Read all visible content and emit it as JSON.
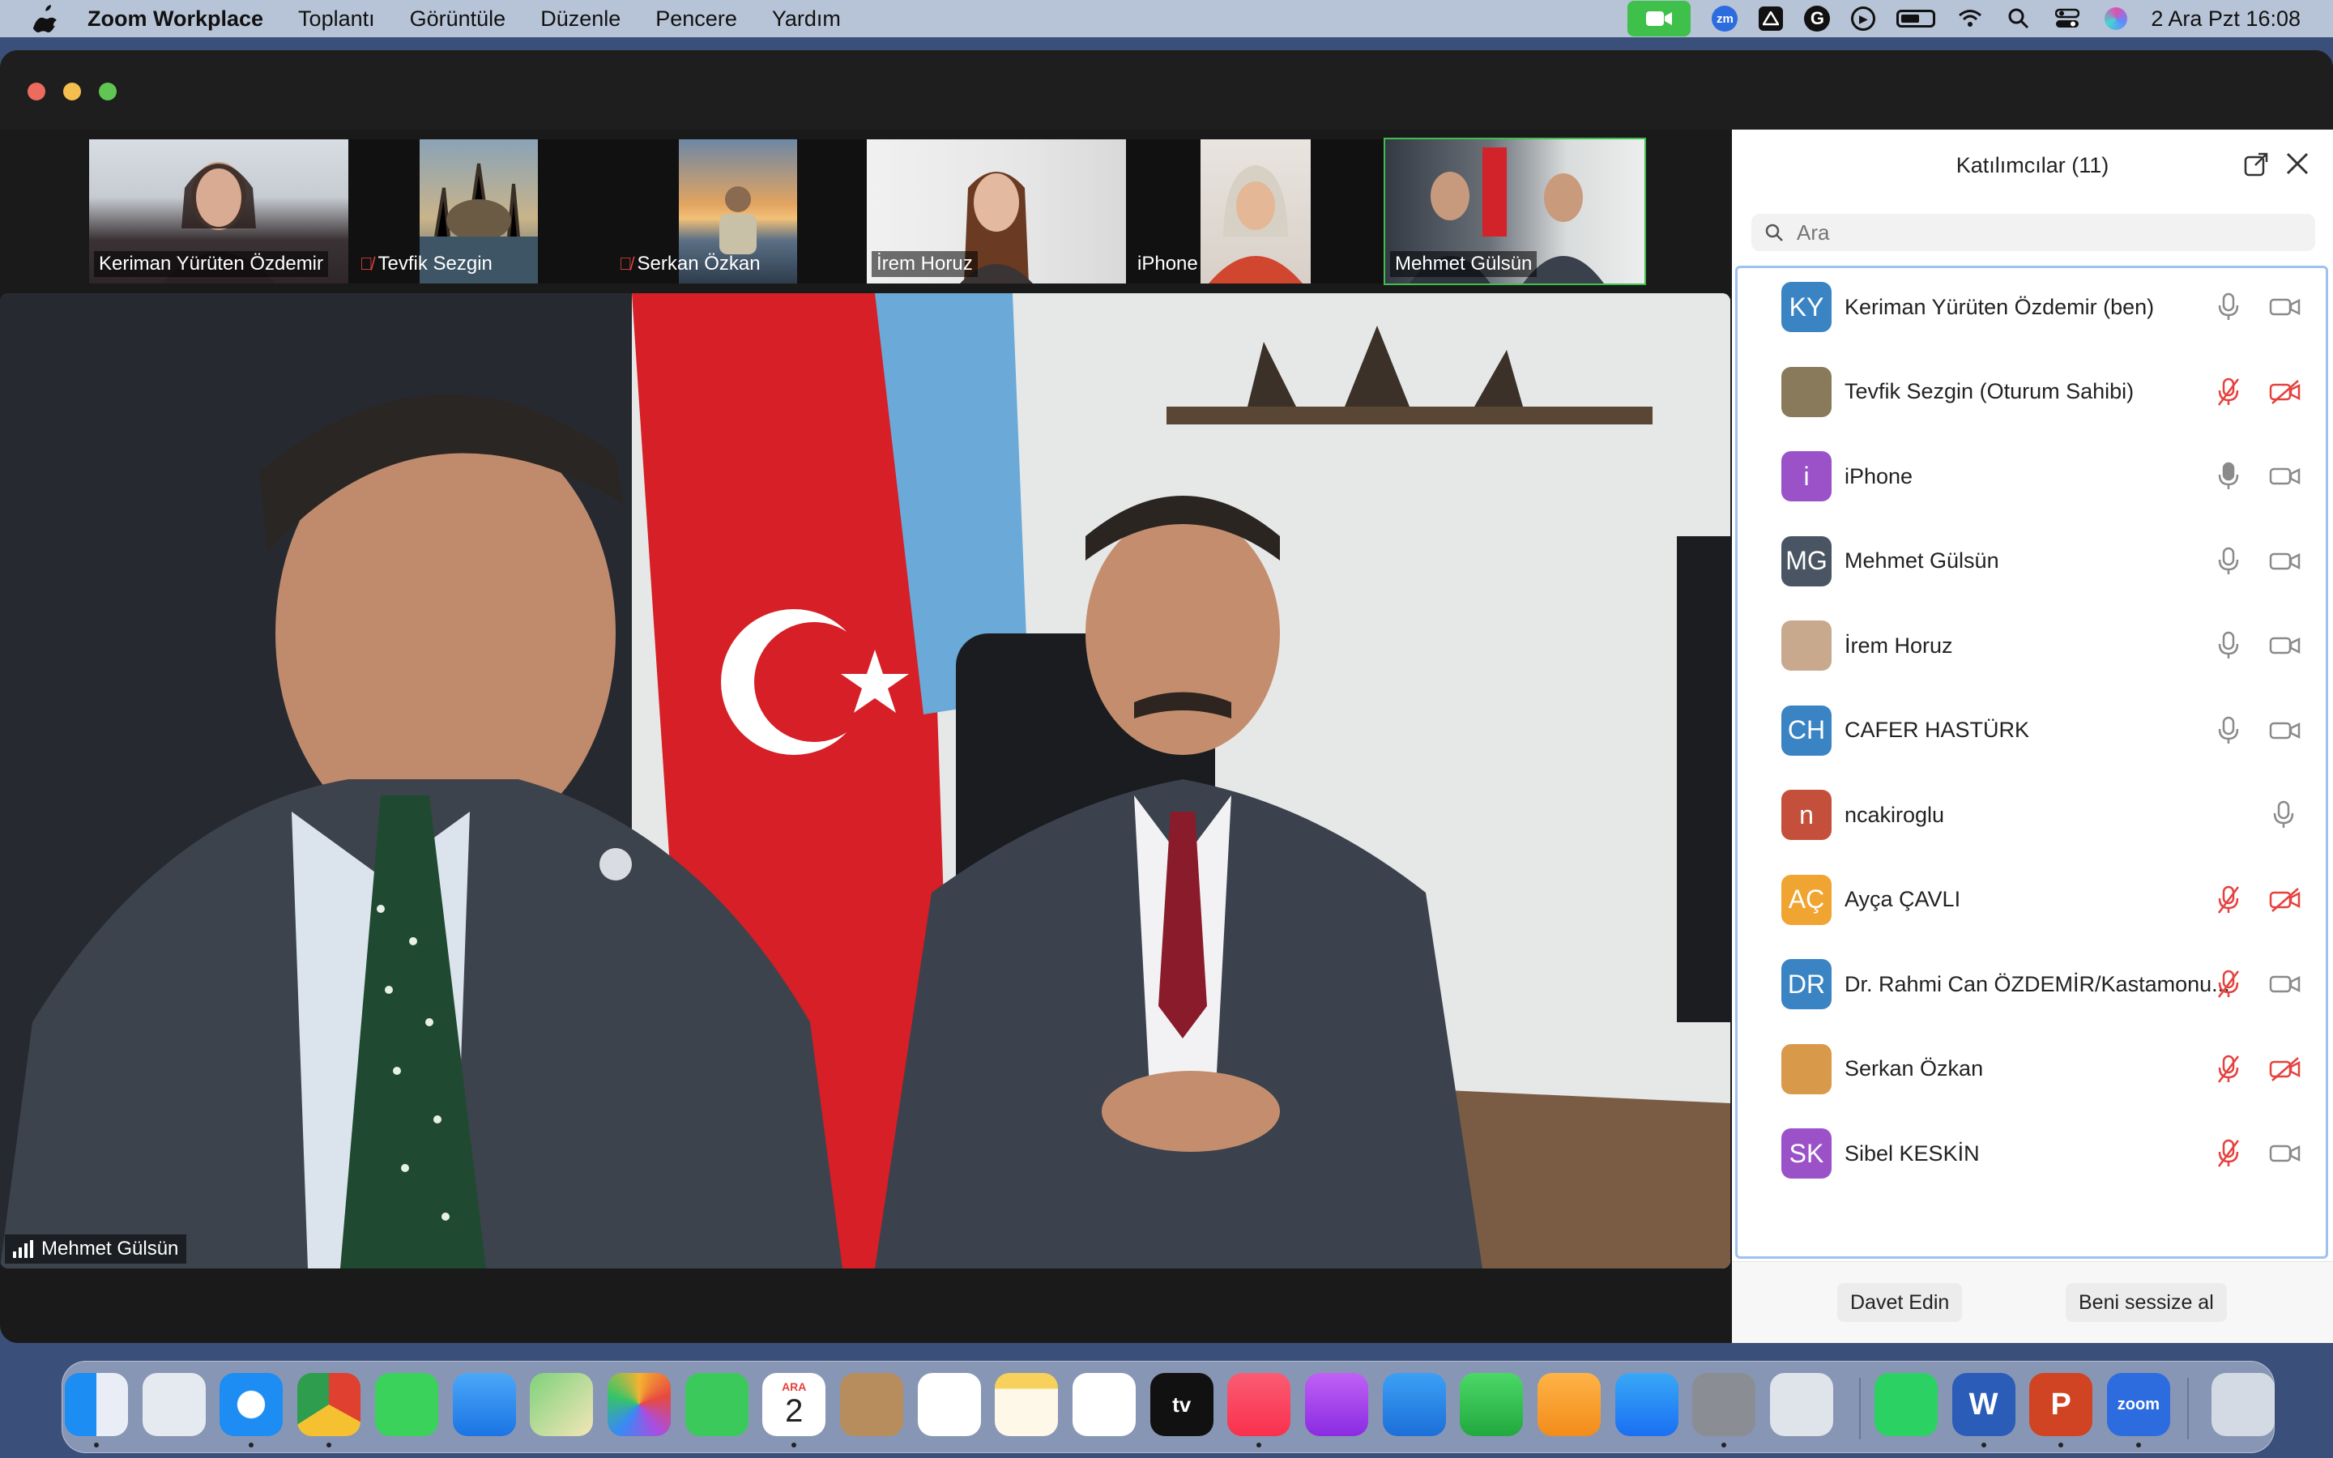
{
  "menubar": {
    "app_name": "Zoom Workplace",
    "menus": [
      "Toplantı",
      "Görüntüle",
      "Düzenle",
      "Pencere",
      "Yardım"
    ],
    "clock": "2 Ara Pzt  16:08",
    "status_icons": [
      "zoom-video-icon",
      "zm-icon",
      "drive-icon",
      "grammarly-icon",
      "play-icon",
      "battery-icon",
      "wifi-icon",
      "search-icon",
      "control-center-icon",
      "siri-icon"
    ],
    "zm_label": "zm",
    "grammarly_label": "G"
  },
  "strip": {
    "thumbnails": [
      {
        "name": "Keriman Yürüten Özdemir",
        "muted": false
      },
      {
        "name": "Tevfik Sezgin",
        "muted": true
      },
      {
        "name": "Serkan Özkan",
        "muted": true
      },
      {
        "name": "İrem Horuz",
        "muted": false
      },
      {
        "name": "iPhone",
        "muted": false
      },
      {
        "name": "Mehmet Gülsün",
        "muted": false,
        "active": true
      }
    ]
  },
  "main_video": {
    "speaker_name": "Mehmet Gülsün"
  },
  "participants": {
    "title": "Katılımcılar (11)",
    "search_placeholder": "Ara",
    "list": [
      {
        "initials": "KY",
        "name": "Keriman Yürüten Özdemir (ben)",
        "color": "#3b84c4",
        "mic": "on",
        "cam": "off"
      },
      {
        "initials": "",
        "name": "Tevfik Sezgin (Oturum Sahibi)",
        "color": "#8a7a5c",
        "mic": "muted",
        "cam": "muted"
      },
      {
        "initials": "i",
        "name": "iPhone",
        "color": "#9b52c9",
        "mic": "active",
        "cam": "off"
      },
      {
        "initials": "MG",
        "name": "Mehmet Gülsün",
        "color": "#4a5563",
        "mic": "on",
        "cam": "off"
      },
      {
        "initials": "",
        "name": "İrem Horuz",
        "color": "#c8a98e",
        "mic": "on",
        "cam": "off"
      },
      {
        "initials": "CH",
        "name": "CAFER HASTÜRK",
        "color": "#3b84c4",
        "mic": "on",
        "cam": "off"
      },
      {
        "initials": "n",
        "name": "ncakiroglu",
        "color": "#c4503b",
        "mic": "on",
        "cam": "none"
      },
      {
        "initials": "AÇ",
        "name": "Ayça ÇAVLI",
        "color": "#f0a431",
        "mic": "muted",
        "cam": "muted"
      },
      {
        "initials": "DR",
        "name": "Dr. Rahmi Can ÖZDEMİR/Kastamonu...",
        "color": "#3b84c4",
        "mic": "muted",
        "cam": "off"
      },
      {
        "initials": "",
        "name": "Serkan Özkan",
        "color": "#d89a4a",
        "mic": "muted",
        "cam": "muted"
      },
      {
        "initials": "SK",
        "name": "Sibel KESKİN",
        "color": "#9b52c9",
        "mic": "muted",
        "cam": "off"
      }
    ],
    "invite_label": "Davet Edin",
    "mute_me_label": "Beni sessize al"
  },
  "dock": {
    "apps": [
      "Finder",
      "Launchpad",
      "Safari",
      "Chrome",
      "Messages",
      "Mail",
      "Maps",
      "Photos",
      "FaceTime",
      "Calendar",
      "Contacts",
      "Reminders",
      "Notes",
      "Freeform",
      "TV",
      "Music",
      "Podcasts",
      "Keynote",
      "Numbers",
      "Pages",
      "App Store",
      "System Settings",
      "iPhone Mirroring",
      "WhatsApp",
      "Word",
      "PowerPoint",
      "Zoom",
      "Trash"
    ],
    "calendar_month": "ARA",
    "calendar_day": "2",
    "tv_label": "tv",
    "word_label": "W",
    "powerpoint_label": "P",
    "zoom_label": "zoom"
  },
  "colors": {
    "accent_green": "#3fc04a",
    "muted_red": "#e5413d",
    "menubar_bg": "#b7c3d6",
    "panel_border": "#9fc1f0"
  }
}
